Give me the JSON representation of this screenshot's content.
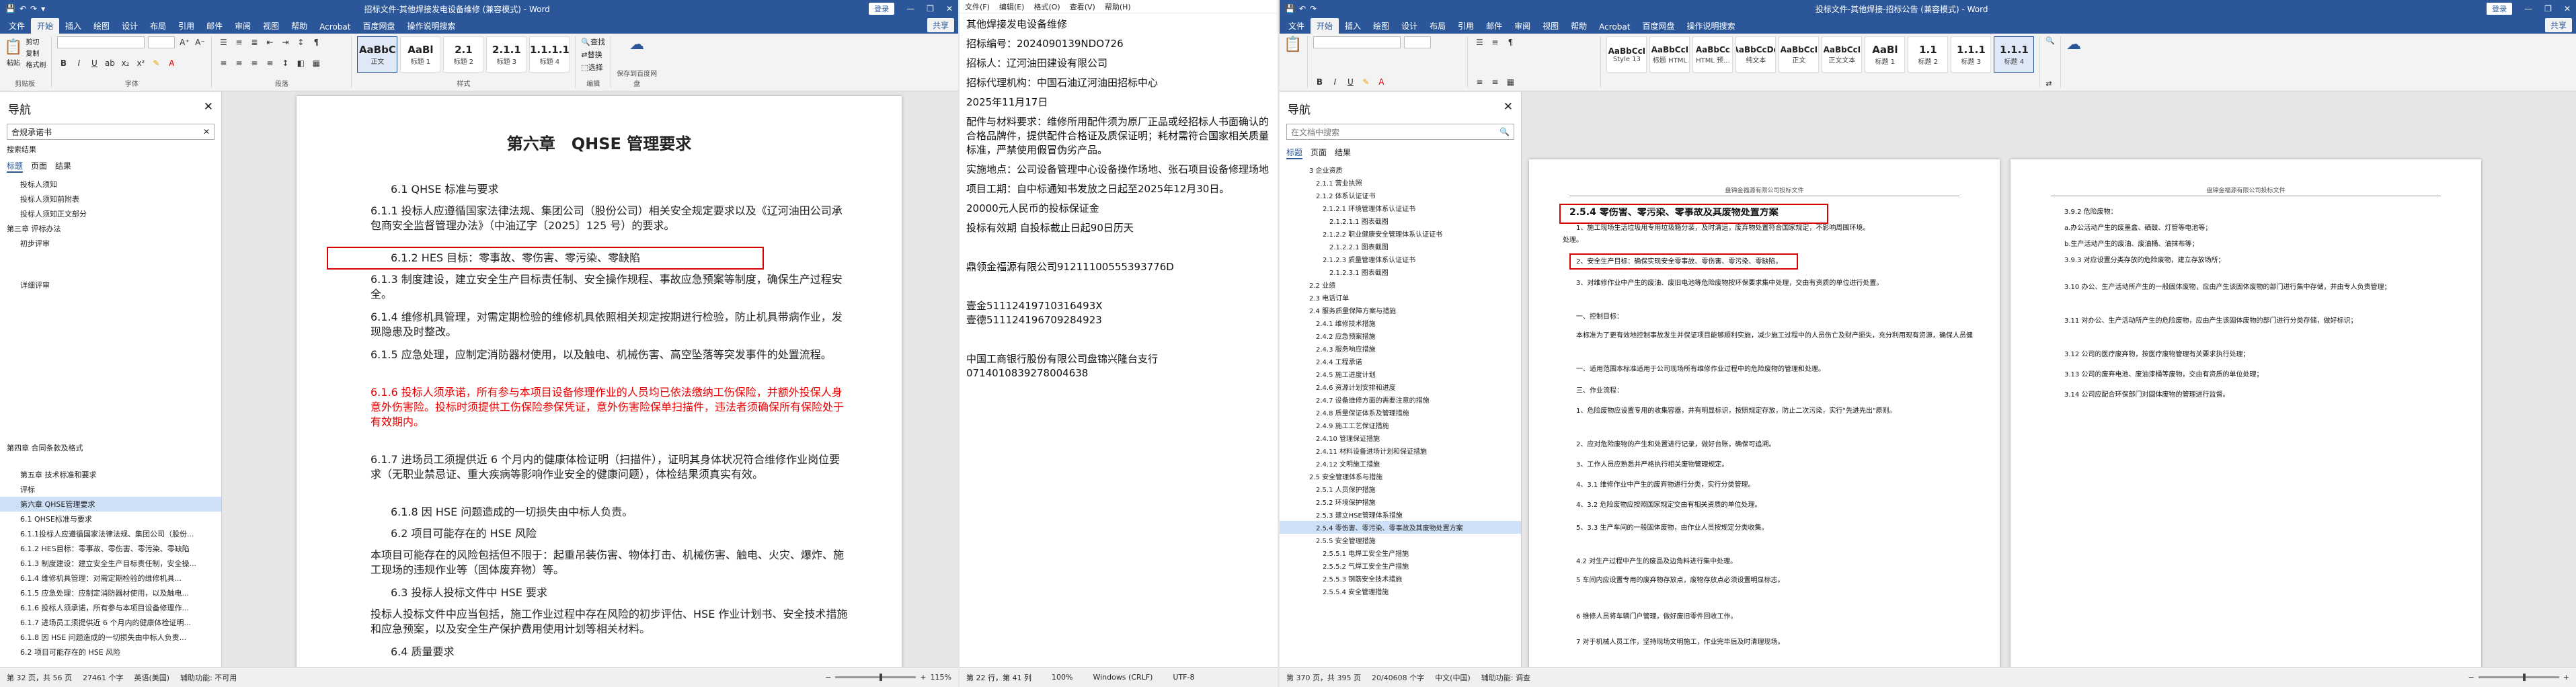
{
  "w1": {
    "qat": [
      "↶",
      "↷",
      "▾"
    ],
    "title": "招标文件-其他焊接发电设备维修 (兼容模式) - Word",
    "login": "登录",
    "tabs": [
      "文件",
      "开始",
      "插入",
      "绘图",
      "设计",
      "布局",
      "引用",
      "邮件",
      "审阅",
      "视图",
      "帮助",
      "Acrobat",
      "百度网盘",
      "操作说明搜索"
    ],
    "share": "共享",
    "clipboard": {
      "paste": "粘贴",
      "cut": "剪切",
      "copy": "复制",
      "painter": "格式刷",
      "label": "剪贴板"
    },
    "font": {
      "name": "",
      "size": "",
      "label": "字体"
    },
    "para": {
      "label": "段落"
    },
    "styles": [
      {
        "p": "AaBbC",
        "n": "正文"
      },
      {
        "p": "AaBl",
        "n": "标题 1"
      },
      {
        "p": "2.1",
        "n": "标题 2"
      },
      {
        "p": "2.1.1",
        "n": "标题 3"
      },
      {
        "p": "1.1.1.1",
        "n": "标题 4"
      }
    ],
    "styles_label": "样式",
    "edit": {
      "find": "查找",
      "replace": "替换",
      "select": "选择",
      "label": "编辑"
    },
    "save": {
      "label": "保存到百度网盘"
    },
    "nav": {
      "title": "导航",
      "search": "合规承诺书",
      "sub": "搜索结果",
      "tabs": [
        "标题",
        "页面",
        "结果"
      ],
      "items": [
        "投标人须知",
        "投标人须知前附表",
        "投标人须知正文部分",
        "第三章 评标办法",
        "初步评审",
        "详细评审",
        "第四章 合同条款及格式",
        "第五章 技术标准和要求",
        "评标",
        "第六章 QHSE管理要求",
        "6.1 QHSE标准与要求",
        "6.1.1投标人应遵循国家法律法规、集团公司（股份...",
        "6.1.2 HES目标：零事故、零伤害、零污染、零缺陷",
        "6.1.3 制度建设：建立安全生产目标责任制，安全操...",
        "6.1.4 维修机具管理：对需定期检验的维修机具...",
        "6.1.5 应急处理：应制定消防器材使用，以及触电...",
        "6.1.6 投标人须承诺，所有参与本项目设备修理作...",
        "6.1.7 进场员工须提供近 6 个月内的健康体检证明...",
        "6.1.8 因 HSE 问题造成的一切损失由中标人负责...",
        "6.2 项目可能存在的 HSE 风险"
      ]
    },
    "doc": {
      "heading": "第六章　QHSE 管理要求",
      "lines": [
        "6.1 QHSE 标准与要求",
        "6.1.1 投标人应遵循国家法律法规、集团公司（股份公司）相关安全规定要求以及《辽河油田公司承包商安全监督管理办法》（中油辽字〔2025〕125 号）的要求。",
        "6.1.2 HES 目标：零事故、零伤害、零污染、零缺陷",
        "6.1.3 制度建设，建立安全生产目标责任制、安全操作规程、事故应急预案等制度，确保生产过程安全。",
        "6.1.4 维修机具管理，对需定期检验的维修机具依照相关规定按期进行检验，防止机具带病作业，发现隐患及时整改。",
        "6.1.5 应急处理，应制定消防器材使用，以及触电、机械伤害、高空坠落等突发事件的处置流程。",
        "6.1.6 投标人须承诺，所有参与本项目设备修理作业的人员均已依法缴纳工伤保险，并额外投保人身意外伤害险。投标时须提供工伤保险参保凭证，意外伤害险保单扫描件，违法者须确保所有保险处于有效期内。",
        "6.1.7 进场员工须提供近 6 个月内的健康体检证明（扫描件），证明其身体状况符合维修作业岗位要求（无职业禁忌证、重大疾病等影响作业安全的健康问题），体检结果须真实有效。",
        "6.1.8 因 HSE 问题造成的一切损失由中标人负责。",
        "6.2 项目可能存在的 HSE 风险",
        "本项目可能存在的风险包括但不限于：起重吊装伤害、物体打击、机械伤害、触电、火灾、爆炸、施工现场的违规作业等（固体废弃物）等。",
        "6.3 投标人投标文件中 HSE 要求",
        "投标人投标文件中应当包括，施工作业过程中存在风险的初步评估、HSE 作业计划书、安全技术措施和应急预案，以及安全生产保护费用使用计划等相关材料。",
        "6.4 质量要求"
      ]
    },
    "status": {
      "page": "第 32 页，共 56 页",
      "words": "27461 个字",
      "lang": "英语(美国)",
      "mode": "辅助功能: 不可用",
      "zoom": "115%"
    }
  },
  "np": {
    "menu": [
      "文件(F)",
      "编辑(E)",
      "格式(O)",
      "查看(V)",
      "帮助(H)"
    ],
    "lines": [
      "其他焊接发电设备维修",
      "招标编号：2024090139NDO726",
      "招标人：辽河油田建设有限公司",
      "招标代理机构：中国石油辽河油田招标中心",
      "2025年11月17日",
      "配件与材料要求：维修所用配件须为原厂正品或经招标人书面确认的合格品牌件，提供配件合格证及质保证明；耗材需符合国家相关质量标准，严禁使用假冒伪劣产品。",
      "实施地点：公司设备管理中心设备操作场地、张石项目设备修理场地",
      "项目工期：自中标通知书发放之日起至2025年12月30日。",
      "20000元人民币的投标保证金",
      "投标有效期 自投标截止日起90日历天",
      "",
      "鼎领金福源有限公司91211100555393776D",
      "",
      "壹金51112419710316493X",
      "壹德511124196709284923",
      "",
      "中国工商银行股份有限公司盘锦兴隆台支行",
      "0714010839278004638"
    ],
    "status": {
      "pos": "第 22 行，第 41 列",
      "zoom": "100%",
      "eol": "Windows (CRLF)",
      "enc": "UTF-8"
    }
  },
  "w2": {
    "title": "投标文件-其他焊接-招标公告 (兼容模式) - Word",
    "login": "登录",
    "tabs": [
      "文件",
      "开始",
      "插入",
      "绘图",
      "设计",
      "布局",
      "引用",
      "邮件",
      "审阅",
      "视图",
      "帮助",
      "Acrobat",
      "百度网盘",
      "操作说明搜索"
    ],
    "share": "共享",
    "styles": [
      {
        "p": "AaBbCcI",
        "n": "Style 13"
      },
      {
        "p": "AaBbCcI",
        "n": "标题 HTML"
      },
      {
        "p": "AaBbCc",
        "n": "HTML 预..."
      },
      {
        "p": "AaBbCcDd",
        "n": "纯文本"
      },
      {
        "p": "AaBbCcI",
        "n": "正文"
      },
      {
        "p": "AaBbCcI",
        "n": "正文文本"
      },
      {
        "p": "AaBl",
        "n": "标题 1"
      },
      {
        "p": "1.1",
        "n": "标题 2"
      },
      {
        "p": "1.1.1",
        "n": "标题 3"
      },
      {
        "p": "1.1.1",
        "n": "标题 4"
      }
    ],
    "nav": {
      "title": "导航",
      "search": "在文档中搜索",
      "tabs": [
        "标题",
        "页面",
        "结果"
      ],
      "items": [
        "3 企业资质",
        "2.1.1 营业执照",
        "2.1.2 体系认证证书",
        "2.1.2.1 环境管理体系认证证书",
        "2.1.2.1.1 图表截图",
        "2.1.2.2 职业健康安全管理体系认证证书",
        "2.1.2.2.1 图表截图",
        "2.1.2.3 质量管理体系认证证书",
        "2.1.2.3.1 图表截图",
        "2.2 业绩",
        "2.3 电话订单",
        "2.4 服务质量保障方案与措施",
        "2.4.1 维修技术措施",
        "2.4.2 应急预案措施",
        "2.4.3 服务响应措施",
        "2.4.4 工程承诺",
        "2.4.5 施工进度计划",
        "2.4.6 资源计划安排和进度",
        "2.4.7 设备维修方面的需要注意的措施",
        "2.4.8 质量保证体系及管理措施",
        "2.4.9 施工工艺保证措施",
        "2.4.10 管理保证措施",
        "2.4.11 材料设备进场计划和保证措施",
        "2.4.12 文明施工措施",
        "2.5 安全管理体系与措施",
        "2.5.1 人员保护措施",
        "2.5.2 环境保护措施",
        "2.5.3 建立HSE管理体系措施",
        "2.5.4 零伤害、零污染、零事故及其废物处置方案",
        "2.5.5 安全管理措施",
        "2.5.5.1 电焊工安全生产措施",
        "2.5.5.2 气焊工安全生产措施",
        "2.5.5.3 钢筋安全技术措施",
        "2.5.5.4 安全管理措施"
      ]
    },
    "page1": {
      "header": "盘锦金福源有限公司投标文件",
      "heading": "2.5.4 零伤害、零污染、零事故及其废物处置方案",
      "lines": [
        "1、施工现场生活垃圾用专用垃圾箱分装，及时清运，废弃物处置符合国家规定，不影响周围环境。",
        "处理。",
        "2、安全生产目标：确保实现安全零事故、零伤害、零污染、零缺陷。",
        "3、对维修作业中产生的废油、废旧电池等危险废物按环保要求集中处理，交由有资质的单位进行处置。",
        "一、控制目标：",
        "本标准为了更有效地控制事故发生并保证项目能够顺利实施，减少施工过程中的人员伤亡及财产损失，充分利用现有资源，确保人员健康，并对周围环境给予保护和控制，具体主要有：",
        "一、适用范围本标准适用于公司现场所有维修作业过程中的危险废物的管理和处理。",
        "三、作业流程：",
        "1、危险废物应设置专用的收集容器，并有明显标识，按照规定存放，防止二次污染，实行\"先进先出\"原则。",
        "2、应对危险废物的产生和处置进行记录，做好台账，确保可追溯。",
        "3、工作人员应熟悉并严格执行相关废物管理规定。",
        "4、3.1 维修作业中产生的废弃物进行分类，实行分类管理。",
        "4、3.2 危险废物应按照国家规定交由有相关资质的单位处理。",
        "5、3.3 生产车间的一般固体废物，由作业人员按规定分类收集。",
        "4.2 对生产过程中产生的废品及边角料进行集中处理。",
        "5 车间内应设置专用的废弃物存放点，废物存放点必须设置明显标志。",
        "6 维修人员将车辆门户管理，做好废旧零件回收工作。",
        "7 对于机械人员工作，坚持现场文明施工，作业完毕后及时清理现场。"
      ]
    },
    "page2": {
      "header": "盘锦金福源有限公司投标文件",
      "lines": [
        "3.9.2 危险废物：",
        "a.办公活动产生的废墨盒、硒鼓、灯管等电池等；",
        "b.生产活动产生的废油、废油桶、油抹布等；",
        "3.9.3 对应设置分类存放的危险废物，建立存放场所；",
        "3.10 办公、生产活动所产生的一般固体废物，应由产生该固体废物的部门进行集中存储，并由专人负责管理；",
        "3.11 对办公、生产活动所产生的危险废物，应由产生该固体废物的部门进行分类存储，做好标识；",
        "3.12 公司的医疗废弃物，按医疗废物管理有关要求执行处理；",
        "3.13 公司的废弃电池、废油漆桶等废物，交由有资质的单位处理；",
        "3.14 公司应配合环保部门对固体废物的管理进行监督。"
      ]
    },
    "status": {
      "page": "第 370 页，共 395 页",
      "words": "20/40608 个字",
      "lang": "中文(中国)",
      "mode": "辅助功能: 调查"
    }
  }
}
